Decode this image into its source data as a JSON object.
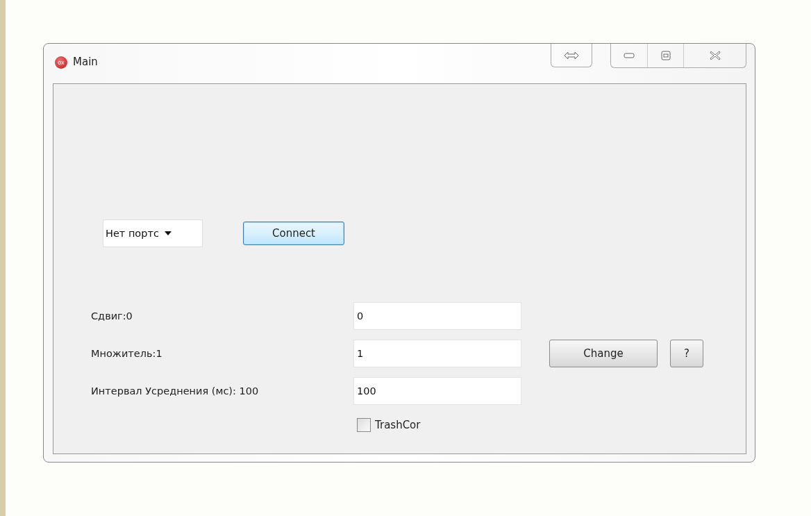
{
  "window": {
    "title": "Main",
    "icon_label": "ox"
  },
  "port_select": {
    "value": "Нет портс"
  },
  "connect_button": {
    "label": "Connect",
    "focused": true
  },
  "parameters": [
    {
      "label": "Сдвиг:0",
      "value": "0"
    },
    {
      "label": "Множитель:1",
      "value": "1"
    },
    {
      "label": "Интервал Усреднения (мс): 100",
      "value": "100"
    }
  ],
  "change_button": {
    "label": "Change",
    "focused": false
  },
  "help_button": {
    "label": "?"
  },
  "trashcor": {
    "label": "TrashCor",
    "checked": false
  }
}
